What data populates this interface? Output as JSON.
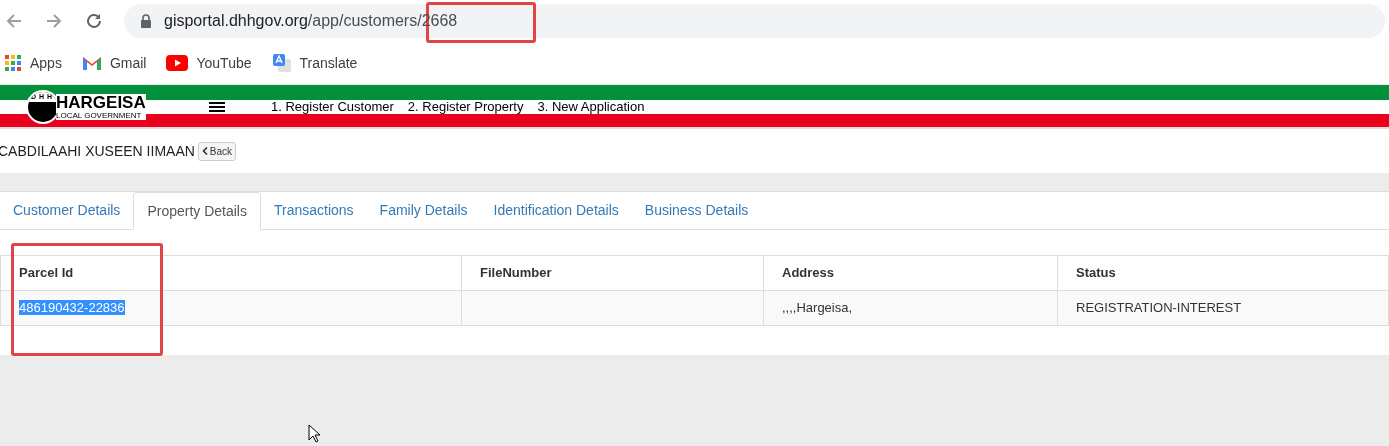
{
  "browser": {
    "url_host": "gisportal.dhhgov.org",
    "url_path": "/app/customers/2668",
    "bookmarks": [
      {
        "label": "Apps",
        "kind": "apps"
      },
      {
        "label": "Gmail",
        "kind": "gmail"
      },
      {
        "label": "YouTube",
        "kind": "youtube"
      },
      {
        "label": "Translate",
        "kind": "translate"
      }
    ]
  },
  "header": {
    "logo_letters": "DHH",
    "logo_title": "HARGEISA",
    "logo_subtitle": "LOCAL GOVERNMENT",
    "nav": [
      "1. Register Customer",
      "2. Register Property",
      "3. New Application"
    ]
  },
  "customer": {
    "name": "CABDILAAHI XUSEEN IIMAAN",
    "back_label": "Back"
  },
  "tabs": [
    {
      "label": "Customer Details",
      "selected": false
    },
    {
      "label": "Property Details",
      "selected": true
    },
    {
      "label": "Transactions",
      "selected": false
    },
    {
      "label": "Family Details",
      "selected": false
    },
    {
      "label": "Identification Details",
      "selected": false
    },
    {
      "label": "Business Details",
      "selected": false
    }
  ],
  "table": {
    "columns": [
      "Parcel Id",
      "FileNumber",
      "Address",
      "Status"
    ],
    "rows": [
      {
        "parcel_id": "486190432-22836",
        "parcel_id_highlighted": true,
        "file_number": "",
        "address": ",,,,Hargeisa,",
        "status": "REGISTRATION-INTEREST"
      }
    ]
  }
}
